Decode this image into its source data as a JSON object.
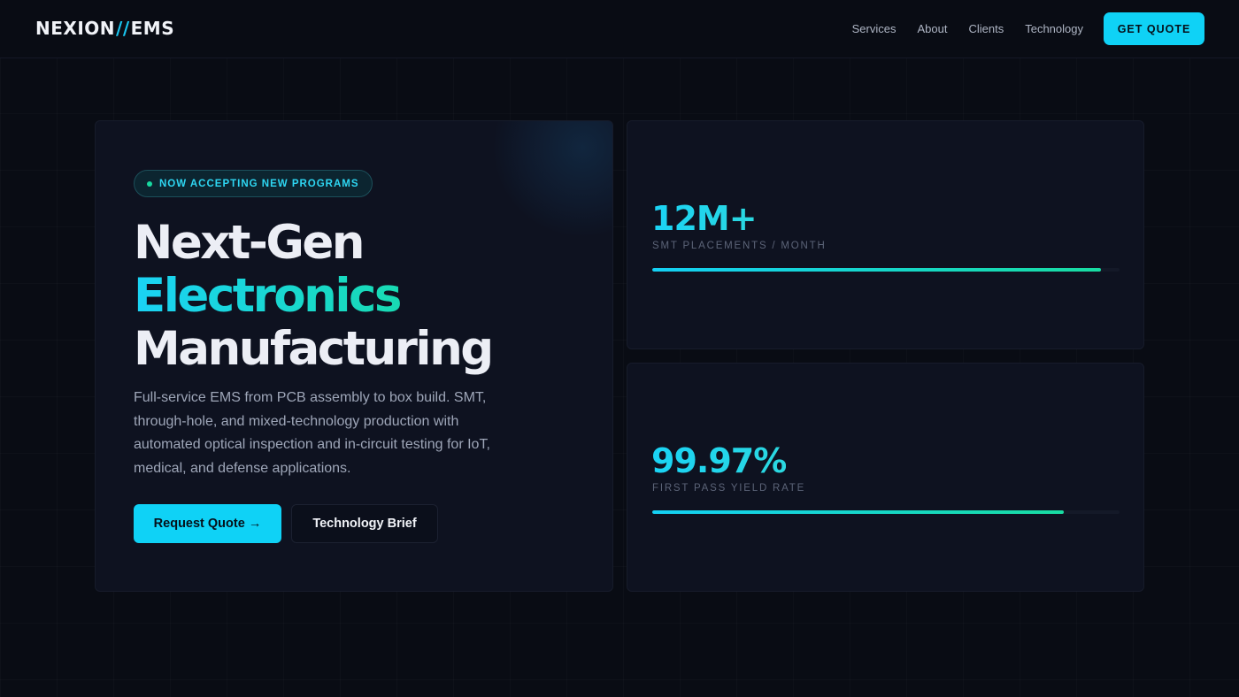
{
  "brand": {
    "part1": "NEXION",
    "slash": "//",
    "part2": "EMS"
  },
  "nav": {
    "links": [
      "Services",
      "About",
      "Clients",
      "Technology"
    ],
    "cta": "GET QUOTE"
  },
  "hero": {
    "badge": "NOW ACCEPTING NEW PROGRAMS",
    "headline": [
      "Next-Gen",
      "Electronics",
      "Manufacturing"
    ],
    "description": "Full-service EMS from PCB assembly to box build. SMT, through-hole, and mixed-technology production with automated optical inspection and in-circuit testing for IoT, medical, and defense applications.",
    "primary_button": "Request Quote →",
    "secondary_button": "Technology Brief"
  },
  "stats": [
    {
      "value": "12M+",
      "label": "SMT PLACEMENTS / MONTH",
      "progress": 0.96
    },
    {
      "value": "99.97%",
      "label": "FIRST PASS YIELD RATE",
      "progress": 0.88
    }
  ],
  "colors": {
    "accent_cyan": "#0fd2f6",
    "accent_green": "#17dd9c",
    "background": "#090c14",
    "card": "#0e1220"
  }
}
